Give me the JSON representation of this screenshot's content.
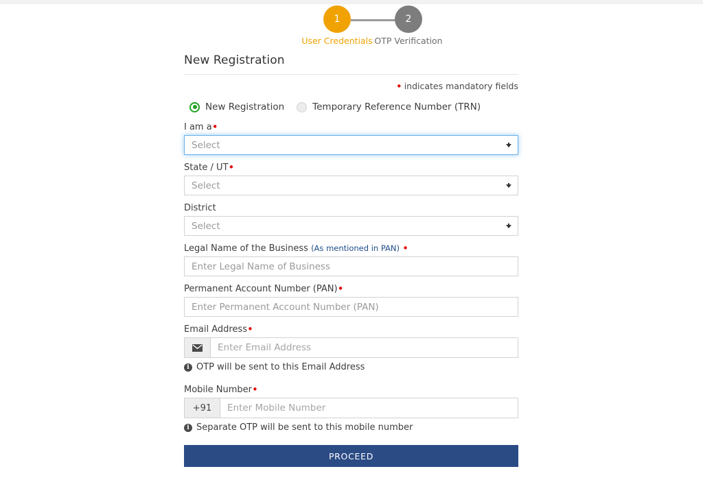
{
  "stepper": {
    "steps": [
      {
        "number": "1",
        "label": "User Credentials",
        "state": "active",
        "color": "#f0a202"
      },
      {
        "number": "2",
        "label": "OTP Verification",
        "state": "inactive",
        "color": "#7d7d7d"
      }
    ]
  },
  "form": {
    "title": "New Registration",
    "mandatory_note": "indicates mandatory fields",
    "mandatory_marker": "•",
    "registration_type": {
      "options": [
        {
          "label": "New Registration",
          "selected": true
        },
        {
          "label": "Temporary Reference Number (TRN)",
          "selected": false
        }
      ]
    },
    "fields": [
      {
        "name": "i-am-a",
        "label": "I am a",
        "required": true,
        "type": "select",
        "value": "Select",
        "focused": true
      },
      {
        "name": "state-ut",
        "label": "State / UT",
        "required": true,
        "type": "select",
        "value": "Select",
        "focused": false
      },
      {
        "name": "district",
        "label": "District",
        "required": false,
        "type": "select",
        "value": "Select",
        "focused": false
      },
      {
        "name": "legal-name",
        "label": "Legal Name of the Business",
        "label_sub": "(As mentioned in PAN)",
        "required": true,
        "type": "text",
        "value": "",
        "placeholder": "Enter Legal Name of Business"
      },
      {
        "name": "pan",
        "label": "Permanent Account Number (PAN)",
        "required": true,
        "type": "text",
        "value": "",
        "placeholder": "Enter Permanent Account Number (PAN)"
      },
      {
        "name": "email",
        "label": "Email Address",
        "required": true,
        "type": "text-addon",
        "addon_icon": "envelope-icon",
        "value": "",
        "placeholder": "Enter Email Address",
        "hint": "OTP will be sent to this Email Address"
      },
      {
        "name": "mobile",
        "label": "Mobile Number",
        "required": true,
        "type": "text-addon",
        "addon_text": "+91",
        "value": "",
        "placeholder": "Enter Mobile Number",
        "hint": "Separate OTP will be sent to this mobile number"
      }
    ],
    "proceed_label": "PROCEED"
  },
  "colors": {
    "active_step": "#f0a202",
    "inactive_step": "#7d7d7d",
    "required_red": "#e60000",
    "radio_green": "#21a121",
    "primary_button": "#2b4b85",
    "label_sub_blue": "#1f4e8c",
    "focus_blue": "#66afe9"
  }
}
